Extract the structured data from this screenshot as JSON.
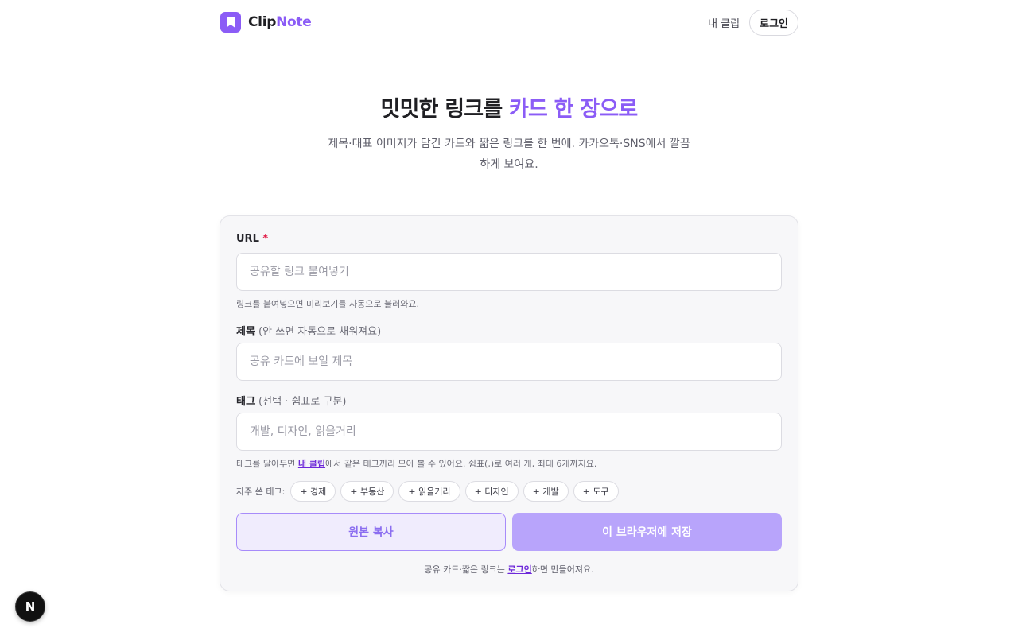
{
  "header": {
    "brand_part1": "Clip",
    "brand_part2": "Note",
    "nav_my_clips": "내 클립",
    "nav_login": "로그인"
  },
  "hero": {
    "title_plain": "밋밋한 링크를 ",
    "title_accent": "카드 한 장으로",
    "subtitle": "제목·대표 이미지가 담긴 카드와 짧은 링크를 한 번에. 카카오톡·SNS에서 깔끔하게 보여요."
  },
  "form": {
    "url": {
      "label": "URL",
      "required_mark": "*",
      "placeholder": "공유할 링크 붙여넣기",
      "value": "",
      "help": "링크를 붙여넣으면 미리보기를 자동으로 불러와요."
    },
    "title": {
      "label": "제목",
      "hint": " (안 쓰면 자동으로 채워져요)",
      "placeholder": "공유 카드에 보일 제목",
      "value": ""
    },
    "tags": {
      "label": "태그",
      "hint": " (선택 · 쉼표로 구분)",
      "placeholder": "개발, 디자인, 읽을거리",
      "value": "",
      "help_before": "태그를 달아두면 ",
      "help_link": "내 클립",
      "help_after": "에서 같은 태그끼리 모아 볼 수 있어요. 쉼표(,)로 여러 개, 최대 6개까지요."
    },
    "frequent_tags_label": "자주 쓴 태그:",
    "frequent_tags": [
      "+ 경제",
      "+ 부동산",
      "+ 읽을거리",
      "+ 디자인",
      "+ 개발",
      "+ 도구"
    ],
    "copy_button": "원본 복사",
    "save_button": "이 브라우저에 저장",
    "footnote_before": "공유 카드·짧은 링크는 ",
    "footnote_link": "로그인",
    "footnote_after": "하면 만들어져요."
  },
  "dev_badge": {
    "letter": "N"
  },
  "colors": {
    "accent": "#8b5cf6",
    "accent_light": "#b8a4fb",
    "required": "#e11d48",
    "link": "#6d28d9"
  },
  "icons": {
    "logo": "bookmark-icon",
    "dev_badge": "nextjs-icon"
  }
}
